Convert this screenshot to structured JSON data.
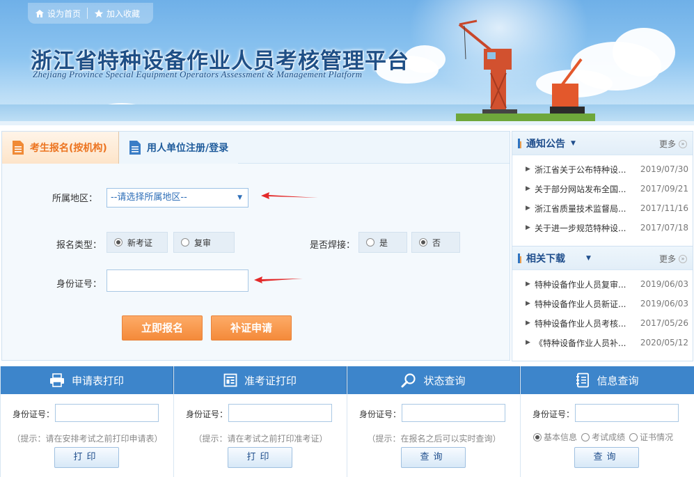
{
  "topnav": {
    "home": "设为首页",
    "favorite": "加入收藏"
  },
  "site": {
    "title": "浙江省特种设备作业人员考核管理平台",
    "subtitle": "Zhejiang Province Special Equipment Operators Assessment & Management Platform"
  },
  "reg": {
    "tab_active": "考生报名(按机构)",
    "tab_inactive": "用人单位注册/登录",
    "region_label": "所属地区：",
    "region_value": "--请选择所属地区--",
    "type_label": "报名类型：",
    "type_options": [
      "新考证",
      "复审"
    ],
    "type_selected": "新考证",
    "weld_label": "是否焊接：",
    "weld_options": [
      "是",
      "否"
    ],
    "weld_selected": "否",
    "id_label": "身份证号：",
    "id_value": "",
    "btn_submit": "立即报名",
    "btn_reissue": "补证申请"
  },
  "notices": {
    "title": "通知公告",
    "more": "更多",
    "items": [
      {
        "text": "浙江省关于公布特种设...",
        "date": "2019/07/30"
      },
      {
        "text": "关于部分网站发布全国...",
        "date": "2017/09/21"
      },
      {
        "text": "浙江省质量技术监督局...",
        "date": "2017/11/16"
      },
      {
        "text": "关于进一步规范特种设...",
        "date": "2017/07/18"
      }
    ]
  },
  "downloads": {
    "title": "相关下载",
    "more": "更多",
    "items": [
      {
        "text": "特种设备作业人员复审...",
        "date": "2019/06/03"
      },
      {
        "text": "特种设备作业人员新证...",
        "date": "2019/06/03"
      },
      {
        "text": "特种设备作业人员考核...",
        "date": "2017/05/26"
      },
      {
        "text": "《特种设备作业人员补...",
        "date": "2020/05/12"
      }
    ]
  },
  "query": [
    {
      "title": "申请表打印",
      "label": "身份证号：",
      "hint": "（提示：请在安排考试之前打印申请表）",
      "button": "打印"
    },
    {
      "title": "准考证打印",
      "label": "身份证号：",
      "hint": "（提示：请在考试之前打印准考证）",
      "button": "打印"
    },
    {
      "title": "状态查询",
      "label": "身份证号：",
      "hint": "（提示：在报名之后可以实时查询）",
      "button": "查询"
    },
    {
      "title": "信息查询",
      "label": "身份证号：",
      "options": [
        "基本信息",
        "考试成绩",
        "证书情况"
      ],
      "selected": "基本信息",
      "button": "查询"
    }
  ],
  "colors": {
    "accent_orange": "#f48a3a",
    "header_blue": "#3d85cb",
    "title_blue": "#1f4e8c"
  }
}
